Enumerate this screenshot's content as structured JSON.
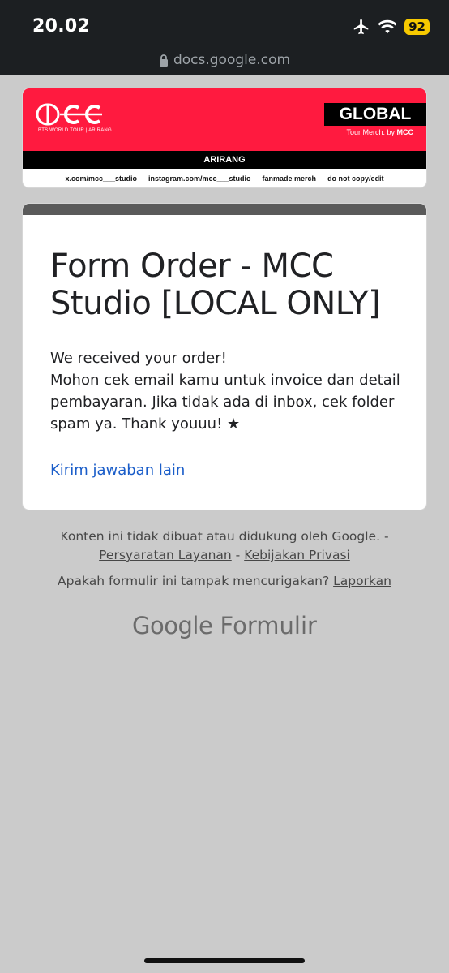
{
  "status": {
    "time": "20.02",
    "battery": "92"
  },
  "browser": {
    "url": "docs.google.com"
  },
  "banner": {
    "brand_sub": "BTS WORLD TOUR | ARIRANG",
    "global": "GLOBAL",
    "tour_merch_prefix": "Tour Merch. by ",
    "tour_merch_brand": "MCC",
    "subtitle": "ARIRANG",
    "links": [
      "x.com/mcc___studio",
      "instagram.com/mcc___studio",
      "fanmade merch",
      "do not copy/edit"
    ],
    "colors": {
      "red": "#ff1a3f",
      "black": "#000000"
    }
  },
  "form": {
    "title": "Form Order - MCC Studio [LOCAL ONLY]",
    "message_line1": "We received your order!",
    "message_line2": "Mohon cek email kamu untuk invoice dan detail pembayaran. Jika tidak ada di inbox, cek folder spam ya. Thank youuu!  ★",
    "another_response": "Kirim jawaban lain"
  },
  "footer": {
    "disclaimer": "Konten ini tidak dibuat atau didukung oleh Google. - ",
    "terms": "Persyaratan Layanan",
    "sep": " - ",
    "privacy": "Kebijakan Privasi",
    "suspicious": "Apakah formulir ini tampak mencurigakan? ",
    "report": "Laporkan",
    "brand_google": "Google",
    "brand_forms": " Formulir"
  }
}
